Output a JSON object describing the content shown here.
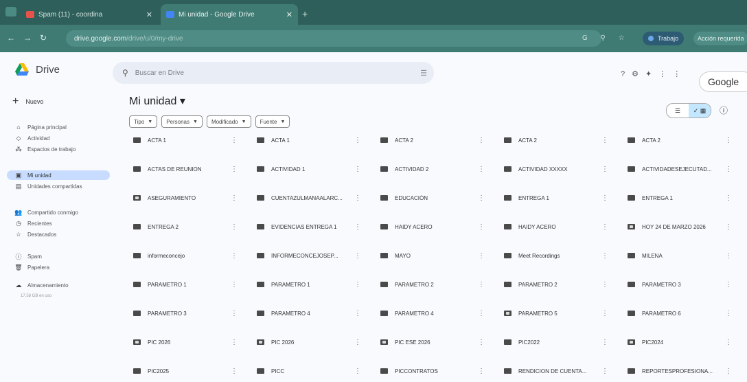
{
  "browser": {
    "tabs": [
      {
        "title": "Spam (11) - coordina",
        "icon": "gmail-icon",
        "color": "#e5534b"
      },
      {
        "title": "Mi unidad - Google Drive",
        "icon": "drive-icon",
        "color": "#4285f4"
      }
    ],
    "url_host": "drive.google.com",
    "url_path": "/drive/u/0/my-drive",
    "profile_label": "Trabajo",
    "extra_label": "Acción requerida"
  },
  "app": {
    "name": "Drive"
  },
  "search": {
    "placeholder": "Buscar en Drive"
  },
  "account": {
    "label": "Google"
  },
  "sidebar": {
    "new_label": "Nuevo",
    "items": [
      {
        "label": "Página principal",
        "icon": "home-icon"
      },
      {
        "label": "Actividad",
        "icon": "activity-icon"
      },
      {
        "label": "Espacios de trabajo",
        "icon": "workspaces-icon"
      },
      {
        "label": "Mi unidad",
        "icon": "my-drive-icon"
      },
      {
        "label": "Unidades compartidas",
        "icon": "shared-drives-icon"
      },
      {
        "label": "Compartido conmigo",
        "icon": "shared-with-me-icon"
      },
      {
        "label": "Recientes",
        "icon": "recent-icon"
      },
      {
        "label": "Destacados",
        "icon": "star-icon"
      },
      {
        "label": "Spam",
        "icon": "spam-icon"
      },
      {
        "label": "Papelera",
        "icon": "trash-icon"
      },
      {
        "label": "Almacenamiento",
        "icon": "cloud-icon"
      }
    ],
    "storage_text": "17,58 GB en uso"
  },
  "main": {
    "title": "Mi unidad",
    "filters": [
      "Tipo",
      "Personas",
      "Modificado",
      "Fuente"
    ],
    "folders": [
      [
        "ACTA 1",
        "ACTA 1",
        "ACTA 2",
        "ACTA 2",
        "ACTA 2"
      ],
      [
        "ACTAS DE REUNION",
        "ACTIVIDAD 1",
        "ACTIVIDAD 2",
        "ACTIVIDAD XXXXX",
        "ACTIVIDADESEJECUTAD..."
      ],
      [
        "ASEGURAMIENTO",
        "CUENTAZULMANAALARC...",
        "EDUCACIÓN",
        "ENTREGA 1",
        "ENTREGA 1"
      ],
      [
        "ENTREGA 2",
        "EVIDENCIAS ENTREGA 1",
        "HAIDY ACERO",
        "HAIDY ACERO",
        "HOY 24 DE MARZO 2026"
      ],
      [
        "informeconcejo",
        "INFORMECONCEJOSEP...",
        "MAYO",
        "Meet Recordings",
        "MILENA"
      ],
      [
        "PARAMETRO 1",
        "PARAMETRO 1",
        "PARAMETRO 2",
        "PARAMETRO 2",
        "PARAMETRO 3"
      ],
      [
        "PARAMETRO 3",
        "PARAMETRO 4",
        "PARAMETRO 4",
        "PARAMETRO 5",
        "PARAMETRO 6"
      ],
      [
        "PIC 2026",
        "PIC 2026",
        "PIC ESE 2026",
        "PIC2022",
        "PIC2024"
      ],
      [
        "PIC2025",
        "PICC",
        "PICCONTRATOS",
        "RENDICION DE CUENTA...",
        "REPORTESPROFESIONA..."
      ]
    ],
    "shared_folders": [
      "ASEGURAMIENTO",
      "HOY 24 DE MARZO 2026",
      "PIC 2026",
      "PIC ESE 2026",
      "PARAMETRO 5",
      "PIC2024"
    ]
  }
}
